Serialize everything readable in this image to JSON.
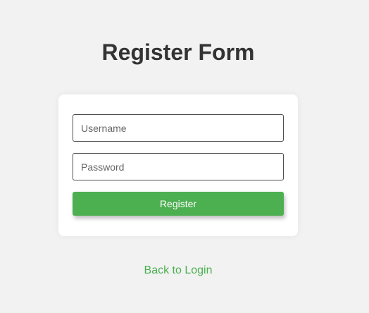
{
  "page": {
    "title": "Register Form"
  },
  "form": {
    "username": {
      "value": "",
      "placeholder": "Username"
    },
    "password": {
      "value": "",
      "placeholder": "Password"
    },
    "submit_label": "Register"
  },
  "footer": {
    "back_link_label": "Back to Login"
  },
  "colors": {
    "background": "#f2f2f2",
    "accent": "#4caf50",
    "title": "#333333"
  }
}
